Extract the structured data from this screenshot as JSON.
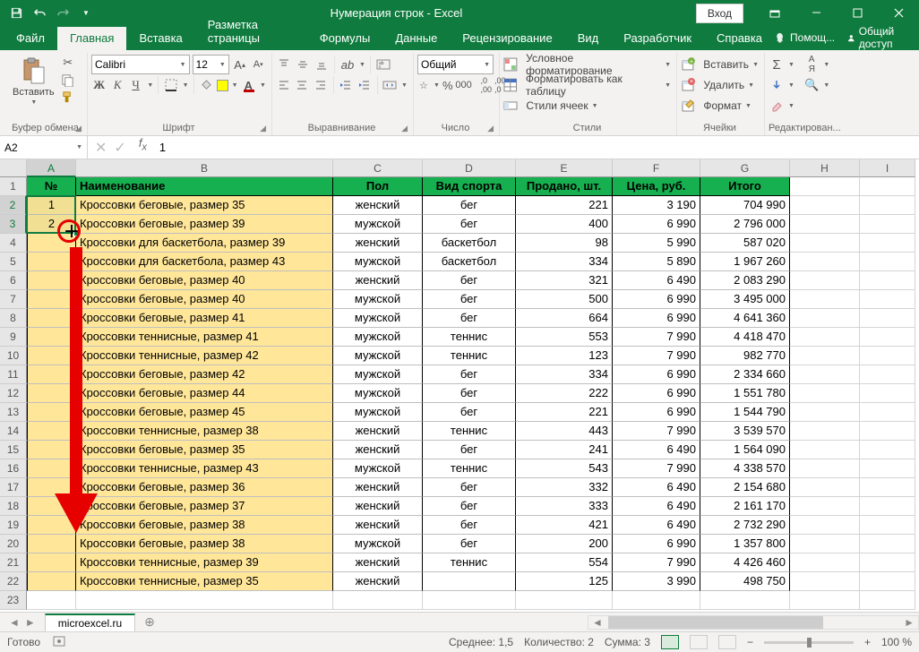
{
  "title": "Нумерация строк  -  Excel",
  "login": "Вход",
  "tabs": [
    "Файл",
    "Главная",
    "Вставка",
    "Разметка страницы",
    "Формулы",
    "Данные",
    "Рецензирование",
    "Вид",
    "Разработчик",
    "Справка"
  ],
  "active_tab": 1,
  "help_hint": "Помощ...",
  "share": "Общий доступ",
  "ribbon": {
    "clipboard": {
      "paste": "Вставить",
      "label": "Буфер обмена"
    },
    "font": {
      "name": "Calibri",
      "size": "12",
      "label": "Шрифт"
    },
    "alignment": {
      "label": "Выравнивание"
    },
    "number": {
      "format": "Общий",
      "label": "Число"
    },
    "styles": {
      "cond": "Условное форматирование",
      "table": "Форматировать как таблицу",
      "cell": "Стили ячеек",
      "label": "Стили"
    },
    "cells": {
      "insert": "Вставить",
      "delete": "Удалить",
      "format": "Формат",
      "label": "Ячейки"
    },
    "editing": {
      "label": "Редактирован..."
    }
  },
  "name_box": "A2",
  "formula_value": "1",
  "columns": [
    "A",
    "B",
    "C",
    "D",
    "E",
    "F",
    "G",
    "H",
    "I"
  ],
  "headers": [
    "№",
    "Наименование",
    "Пол",
    "Вид спорта",
    "Продано, шт.",
    "Цена, руб.",
    "Итого"
  ],
  "rows": [
    {
      "n": "1",
      "name": "Кроссовки беговые, размер 35",
      "sex": "женский",
      "sport": "бег",
      "sold": "221",
      "price": "3 190",
      "total": "704 990"
    },
    {
      "n": "2",
      "name": "Кроссовки беговые, размер 39",
      "sex": "мужской",
      "sport": "бег",
      "sold": "400",
      "price": "6 990",
      "total": "2 796 000"
    },
    {
      "n": "",
      "name": "Кроссовки для баскетбола, размер 39",
      "sex": "женский",
      "sport": "баскетбол",
      "sold": "98",
      "price": "5 990",
      "total": "587 020"
    },
    {
      "n": "",
      "name": "Кроссовки для баскетбола, размер 43",
      "sex": "мужской",
      "sport": "баскетбол",
      "sold": "334",
      "price": "5 890",
      "total": "1 967 260"
    },
    {
      "n": "",
      "name": "Кроссовки беговые, размер 40",
      "sex": "женский",
      "sport": "бег",
      "sold": "321",
      "price": "6 490",
      "total": "2 083 290"
    },
    {
      "n": "",
      "name": "Кроссовки беговые, размер 40",
      "sex": "мужской",
      "sport": "бег",
      "sold": "500",
      "price": "6 990",
      "total": "3 495 000"
    },
    {
      "n": "",
      "name": "Кроссовки беговые, размер 41",
      "sex": "мужской",
      "sport": "бег",
      "sold": "664",
      "price": "6 990",
      "total": "4 641 360"
    },
    {
      "n": "",
      "name": "Кроссовки теннисные, размер 41",
      "sex": "мужской",
      "sport": "теннис",
      "sold": "553",
      "price": "7 990",
      "total": "4 418 470"
    },
    {
      "n": "",
      "name": "Кроссовки теннисные, размер 42",
      "sex": "мужской",
      "sport": "теннис",
      "sold": "123",
      "price": "7 990",
      "total": "982 770"
    },
    {
      "n": "",
      "name": "Кроссовки беговые, размер 42",
      "sex": "мужской",
      "sport": "бег",
      "sold": "334",
      "price": "6 990",
      "total": "2 334 660"
    },
    {
      "n": "",
      "name": "Кроссовки беговые, размер 44",
      "sex": "мужской",
      "sport": "бег",
      "sold": "222",
      "price": "6 990",
      "total": "1 551 780"
    },
    {
      "n": "",
      "name": "Кроссовки беговые, размер 45",
      "sex": "мужской",
      "sport": "бег",
      "sold": "221",
      "price": "6 990",
      "total": "1 544 790"
    },
    {
      "n": "",
      "name": "Кроссовки теннисные, размер 38",
      "sex": "женский",
      "sport": "теннис",
      "sold": "443",
      "price": "7 990",
      "total": "3 539 570"
    },
    {
      "n": "",
      "name": "Кроссовки беговые, размер 35",
      "sex": "женский",
      "sport": "бег",
      "sold": "241",
      "price": "6 490",
      "total": "1 564 090"
    },
    {
      "n": "",
      "name": "Кроссовки теннисные, размер 43",
      "sex": "мужской",
      "sport": "теннис",
      "sold": "543",
      "price": "7 990",
      "total": "4 338 570"
    },
    {
      "n": "",
      "name": "Кроссовки беговые, размер 36",
      "sex": "женский",
      "sport": "бег",
      "sold": "332",
      "price": "6 490",
      "total": "2 154 680"
    },
    {
      "n": "",
      "name": "Кроссовки беговые, размер 37",
      "sex": "женский",
      "sport": "бег",
      "sold": "333",
      "price": "6 490",
      "total": "2 161 170"
    },
    {
      "n": "",
      "name": "Кроссовки беговые, размер 38",
      "sex": "женский",
      "sport": "бег",
      "sold": "421",
      "price": "6 490",
      "total": "2 732 290"
    },
    {
      "n": "",
      "name": "Кроссовки беговые, размер 38",
      "sex": "мужской",
      "sport": "бег",
      "sold": "200",
      "price": "6 990",
      "total": "1 357 800"
    },
    {
      "n": "",
      "name": "Кроссовки теннисные, размер 39",
      "sex": "женский",
      "sport": "теннис",
      "sold": "554",
      "price": "7 990",
      "total": "4 426 460"
    },
    {
      "n": "",
      "name": "Кроссовки теннисные, размер 35",
      "sex": "женский",
      "sport": "",
      "sold": "125",
      "price": "3 990",
      "total": "498 750"
    }
  ],
  "sheet_name": "microexcel.ru",
  "status": {
    "ready": "Готово",
    "avg": "Среднее: 1,5",
    "count": "Количество: 2",
    "sum": "Сумма: 3",
    "zoom": "100 %"
  }
}
